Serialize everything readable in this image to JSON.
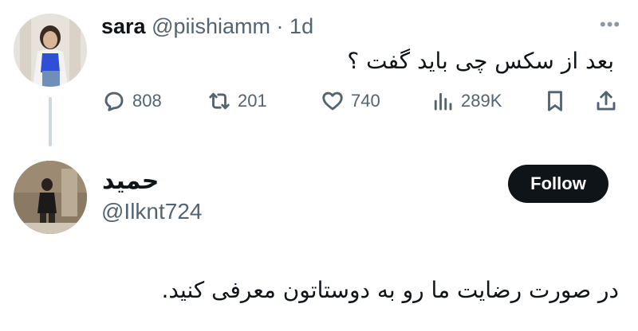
{
  "tweet": {
    "name": "sara",
    "handle": "@piishiamm",
    "separator": "·",
    "time": "1d",
    "more_icon": "ellipsis-icon",
    "text": "بعد از سکس چی باید گفت ؟",
    "actions": {
      "replies": "808",
      "retweets": "201",
      "likes": "740",
      "views": "289K"
    }
  },
  "profile": {
    "name": "حمید",
    "handle": "@Ilknt724",
    "follow_label": "Follow",
    "bio": "در صورت رضایت ما رو به دوستاتون معرفی کنید."
  },
  "colors": {
    "text_primary": "#0f1419",
    "text_secondary": "#536471",
    "thread_line": "#cfd9de",
    "follow_bg": "#0f1419"
  }
}
